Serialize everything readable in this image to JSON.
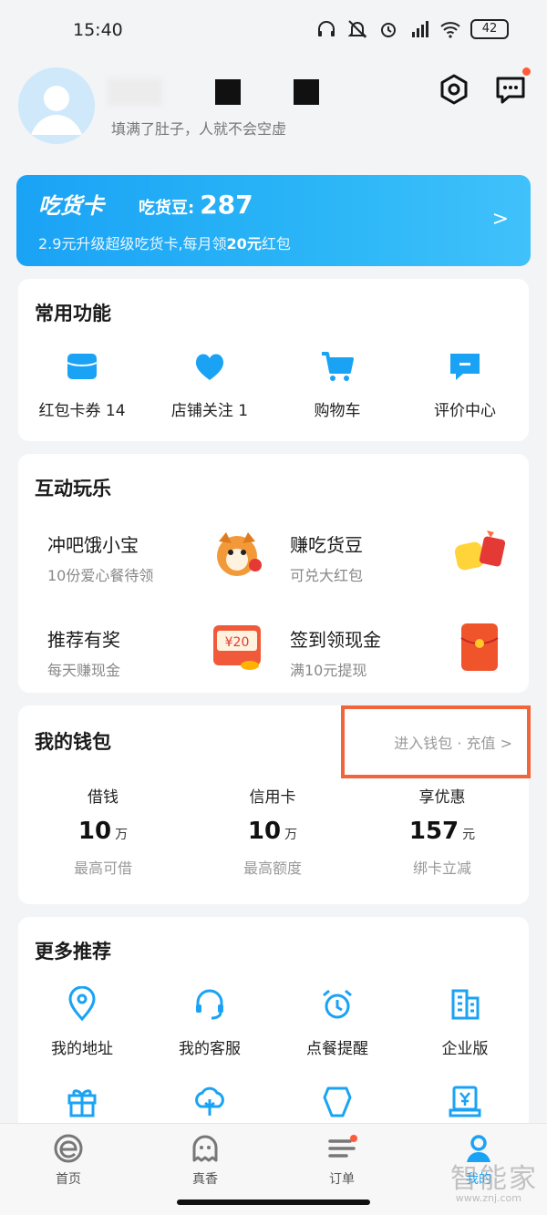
{
  "status_bar": {
    "time": "15:40",
    "battery": "42",
    "icons": [
      "headphones-icon",
      "mute-icon",
      "alarm-icon",
      "hd-signal-icon",
      "wifi-icon",
      "battery-icon"
    ]
  },
  "profile": {
    "motto": "填满了肚子，人就不会空虚",
    "settings_icon": "settings-icon",
    "message_icon": "message-icon"
  },
  "vip_card": {
    "title": "吃货卡",
    "beans_label": "吃货豆:",
    "beans_value": "287",
    "promo_prefix": "2.9元升级超级吃货卡,每月领",
    "promo_bold": "20元",
    "promo_suffix": "红包"
  },
  "common_functions": {
    "title": "常用功能",
    "items": [
      {
        "label": "红包卡券 14",
        "icon": "coupon-icon"
      },
      {
        "label": "店铺关注 1",
        "icon": "heart-icon"
      },
      {
        "label": "购物车",
        "icon": "cart-icon"
      },
      {
        "label": "评价中心",
        "icon": "comment-icon"
      }
    ]
  },
  "interactive": {
    "title": "互动玩乐",
    "items": [
      {
        "title": "冲吧饿小宝",
        "subtitle": "10份爱心餐待领"
      },
      {
        "title": "赚吃货豆",
        "subtitle": "可兑大红包"
      },
      {
        "title": "推荐有奖",
        "subtitle": "每天赚现金",
        "badge": "¥20"
      },
      {
        "title": "签到领现金",
        "subtitle": "满10元提现"
      }
    ]
  },
  "wallet": {
    "title": "我的钱包",
    "link": "进入钱包 · 充值",
    "columns": [
      {
        "label": "借钱",
        "value": "10",
        "unit": "万",
        "sub": "最高可借"
      },
      {
        "label": "信用卡",
        "value": "10",
        "unit": "万",
        "sub": "最高额度"
      },
      {
        "label": "享优惠",
        "value": "157",
        "unit": "元",
        "sub": "绑卡立减"
      }
    ]
  },
  "more": {
    "title": "更多推荐",
    "items": [
      {
        "label": "我的地址",
        "icon": "location-icon"
      },
      {
        "label": "我的客服",
        "icon": "headset-icon"
      },
      {
        "label": "点餐提醒",
        "icon": "alarm-clock-icon"
      },
      {
        "label": "企业版",
        "icon": "building-icon"
      }
    ],
    "row2_icons": [
      "gift-icon",
      "tree-icon",
      "shield-icon",
      "receipt-icon"
    ]
  },
  "tabbar": {
    "tabs": [
      {
        "label": "首页",
        "icon": "home-e-icon"
      },
      {
        "label": "真香",
        "icon": "ghost-icon"
      },
      {
        "label": "订单",
        "icon": "order-list-icon"
      },
      {
        "label": "我的",
        "icon": "profile-icon"
      }
    ],
    "active": "我的"
  },
  "watermark": {
    "text": "智能家",
    "sub": "www.znj.com"
  },
  "colors": {
    "accent": "#1aa3f5",
    "highlight": "#f1643c",
    "badge": "#ff5b3a"
  }
}
